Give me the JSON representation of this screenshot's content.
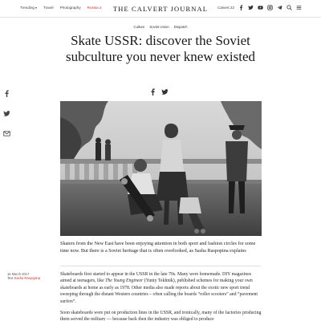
{
  "nav": {
    "trending": "Trending",
    "travel": "Travel",
    "photography": "Photography",
    "russia": "Russia 2"
  },
  "site": {
    "logo": "THE CALVERT JOURNAL"
  },
  "tools": {
    "issue": "Calvert 22"
  },
  "tags": [
    "Culture",
    "Soviet Union",
    "Dispatch"
  ],
  "article": {
    "headline": "Skate USSR: discover the Soviet subculture you never knew existed",
    "intro": "Skaters from the New East have been enjoying attention in both sport and fashion circles for some time now. But there is a Soviet heritage that is often overlooked, as Sasha Raspopina explains",
    "date": "16 March 2017",
    "author_label": "Text",
    "author": "Sasha Raspopina",
    "p1_a": "Skateboards first started to appear in the USSR in the late 70s. Many were homemade. DIY magazines aimed at teenagers, like ",
    "p1_em": "The Young Engineer",
    "p1_b": " (Yuniy Tekhnik), published schemes for making your own skateboards at home as early as 1978. Other media also made reports about the exotic new sport trend sweeping through the distant Western countries – often calling the boards “roller scooters” and “pavement surfers”.",
    "p2": "Soon skateboards were put on production lines in the USSR, and ironically, many of the factories producing them served the military — because back then the industry was obliged to produce"
  },
  "colors": {
    "accent": "#d0342c",
    "text": "#222222",
    "rule": "#e3e3e3"
  },
  "icons": [
    "chevron-down-icon",
    "facebook-icon",
    "twitter-icon",
    "youtube-icon",
    "instagram-icon",
    "telegram-icon",
    "search-icon",
    "menu-icon",
    "email-icon"
  ]
}
